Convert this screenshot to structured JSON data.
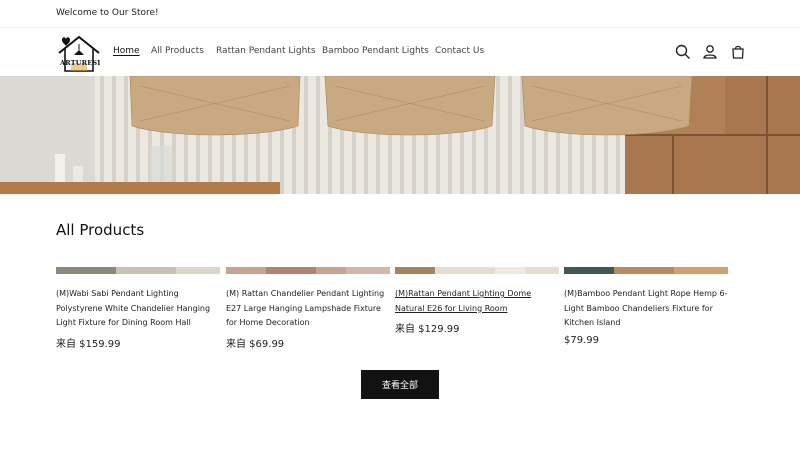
{
  "announcement": {
    "text": "Welcome to Our Store!"
  },
  "header": {
    "logo_text": "ARTURESI",
    "nav": [
      {
        "label": "Home",
        "active": true
      },
      {
        "label": "All Products",
        "active": false
      },
      {
        "label": "Rattan Pendant Lights",
        "active": false
      },
      {
        "label": "Bamboo Pendant Lights",
        "active": false
      },
      {
        "label": "Contact Us",
        "active": false
      }
    ],
    "icons": [
      "search-icon",
      "account-icon",
      "cart-icon"
    ]
  },
  "section": {
    "title": "All Products"
  },
  "products": [
    {
      "title": "(M)Wabi Sabi Pendant Lighting Polystyrene White Chandelier Hanging Light Fixture for Dining Room Hall",
      "price": "来自 $159.99"
    },
    {
      "title": "(M) Rattan Chandelier Pendant Lighting E27 Large Hanging Lampshade Fixture for Home Decoration",
      "price": "来自 $69.99"
    },
    {
      "title": "(M)Rattan Pendant Lighting Dome Natural E26 for Living Room",
      "price": "来自 $129.99"
    },
    {
      "title": "(M)Bamboo Pendant Light Rope Hemp 6-Light Bamboo Chandeliers Fixture for Kitchen Island",
      "price": "$79.99"
    }
  ],
  "view_all": {
    "label": "查看全部"
  },
  "colors": {
    "button_bg": "#121212",
    "button_text": "#ffffff",
    "border": "#ececec"
  }
}
